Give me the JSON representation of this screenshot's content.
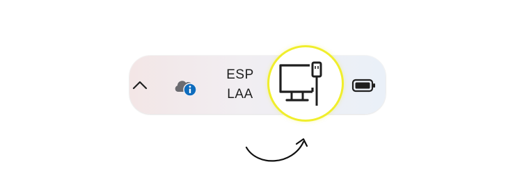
{
  "taskbar_tray": {
    "show_hidden_icons": {
      "icon": "chevron-up-icon"
    },
    "onedrive": {
      "icon": "onedrive-info-icon",
      "accent": "#0f6cbd"
    },
    "language": {
      "line1": "ESP",
      "line2": "LAA"
    },
    "network": {
      "icon": "network-wired-icon",
      "highlight_color": "#f0ee2c"
    },
    "battery": {
      "icon": "battery-icon"
    }
  },
  "annotation": {
    "icon": "curved-arrow-icon"
  }
}
